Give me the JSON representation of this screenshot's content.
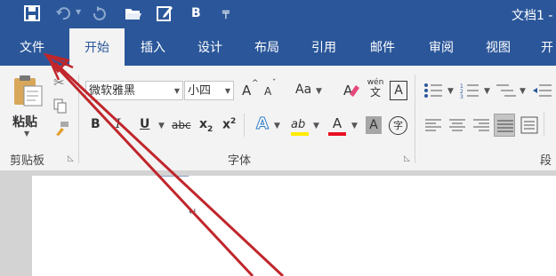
{
  "qat": {
    "doc_title": "文档1 -",
    "font_style_label": "B",
    "icons": [
      "save-icon",
      "undo-icon",
      "redo-icon",
      "open-folder-icon",
      "edit-icon",
      "customize-qat-icon"
    ]
  },
  "tabs": [
    {
      "label": "文件"
    },
    {
      "label": "开始"
    },
    {
      "label": "插入"
    },
    {
      "label": "设计"
    },
    {
      "label": "布局"
    },
    {
      "label": "引用"
    },
    {
      "label": "邮件"
    },
    {
      "label": "审阅"
    },
    {
      "label": "视图"
    },
    {
      "label": "开"
    }
  ],
  "clipboard": {
    "paste_label": "粘贴",
    "group_label": "剪贴板"
  },
  "font": {
    "font_name": "微软雅黑",
    "font_size": "小四",
    "grow": "A",
    "shrink": "A",
    "change_case": "Aa",
    "phonetic_top": "wén",
    "phonetic_bottom": "文",
    "char_border": "A",
    "bold": "B",
    "italic": "I",
    "underline": "U",
    "strikethrough": "abc",
    "subscript": "x",
    "subscript_mark": "2",
    "superscript": "x",
    "superscript_mark": "2",
    "text_effects": "A",
    "highlight": "ab",
    "font_color": "A",
    "char_shading": "A",
    "enclose": "字",
    "group_label": "字体"
  },
  "paragraph": {
    "group_label": "段"
  },
  "document": {
    "return_mark": "↵"
  },
  "colors": {
    "ribbon_blue": "#2b579a",
    "arrow_red": "#c0262b",
    "font_color_bar": "#e81123",
    "highlight_bar": "#ffeb00"
  }
}
